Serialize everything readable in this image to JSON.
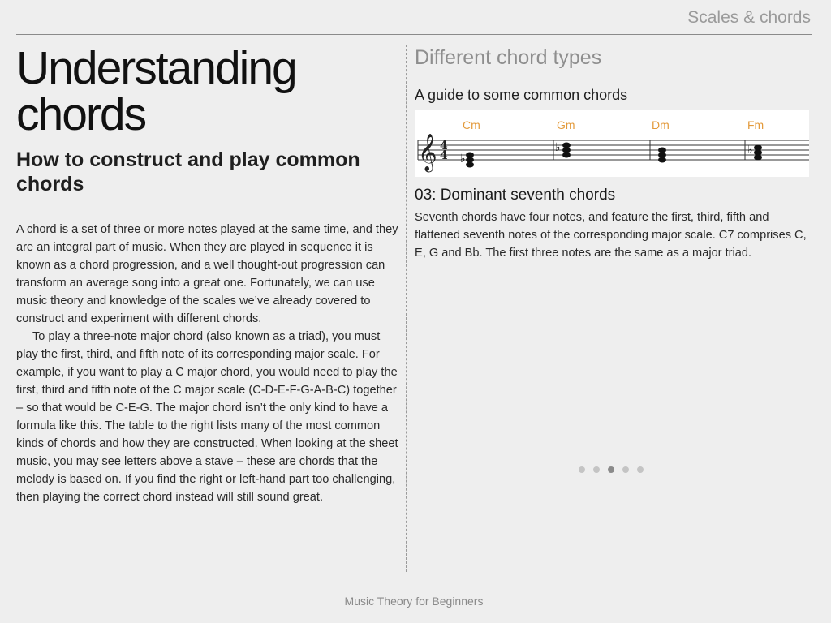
{
  "header": {
    "section_title": "Scales & chords"
  },
  "left": {
    "title_line1": "Understanding",
    "title_line2": "chords",
    "subtitle": "How to construct and play common chords",
    "paragraphs": [
      "A chord is a set of three or more notes played at the same time, and they are an integral part of music. When they are played in sequence it is known as a chord progression, and a well thought-out progression can transform an average song into a great one. Fortunately, we can use music theory and knowledge of the scales we’ve already covered to construct and experiment with different chords.",
      "To play a three-note major chord (also known as a triad), you must play the first, third, and fifth note of its corresponding major scale. For example, if you want to play a C major chord, you would need to play the first, third and fifth note of the C major scale (C-D-E-F-G-A-B-C) together – so that would be C-E-G. The major chord isn’t the only kind to have a formula like this. The table to the right lists many of the most common kinds of chords and how they are constructed. When looking at the sheet music, you may see letters above a stave – these are chords that the melody is based on. If you find the right or left-hand part too challenging, then playing the correct chord instead will still sound great."
    ]
  },
  "right": {
    "heading": "Different chord types",
    "subheading": "A guide to some common chords",
    "chords": [
      "Cm",
      "Gm",
      "Dm",
      "Fm"
    ],
    "time_signature": {
      "top": "4",
      "bottom": "4"
    },
    "section_heading": "03: Dominant seventh chords",
    "section_body": "Seventh chords have four notes, and feature the first, third, fifth and flattened seventh notes of the corresponding major scale. C7 comprises C, E, G and Bb. The first three notes are the same as a major triad."
  },
  "pager": {
    "count": 5,
    "active_index": 2
  },
  "footer": {
    "text": "Music Theory for Beginners"
  },
  "colors": {
    "chord_label": "#e39a3b",
    "background": "#eeeeee"
  }
}
